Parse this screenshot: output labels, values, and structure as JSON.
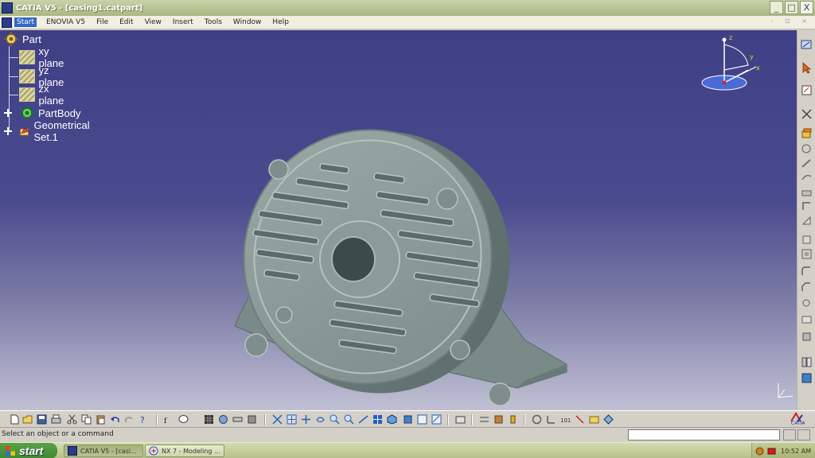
{
  "window": {
    "title": "CATIA V5 - [casing1.catpart]",
    "buttons": [
      "_",
      "□",
      "X"
    ]
  },
  "menu": {
    "items": [
      "Start",
      "ENOVIA V5",
      "File",
      "Edit",
      "View",
      "Insert",
      "Tools",
      "Window",
      "Help"
    ],
    "right": "- ⊡ ×"
  },
  "tree": {
    "root": "Part",
    "planes": [
      "xy plane",
      "yz plane",
      "zx plane"
    ],
    "part_body": "PartBody",
    "geometrical_set": "Geometrical Set.1"
  },
  "compass": {
    "axis_z": "z",
    "axis_y": "y",
    "axis_x": "x"
  },
  "status": {
    "message": "Select an object or a command",
    "input_value": ""
  },
  "branding": {
    "logo_text": "CATIA"
  },
  "taskbar": {
    "start_label": "start",
    "tasks": [
      "CATIA V5 - [casi...",
      "NX 7 - Modeling ..."
    ],
    "clock": "10:52 AM"
  },
  "colors": {
    "viewport_top": "#3f3f86",
    "viewport_bottom": "#c0c0d4",
    "part_fill": "#8b9a98",
    "title_bar": "#a9b882",
    "start_green": "#3c8a2e"
  },
  "icons": {
    "toolbar_bottom": [
      "new-icon",
      "open-icon",
      "save-icon",
      "print-icon",
      "cut-icon",
      "copy-icon",
      "paste-icon",
      "undo-icon",
      "redo-icon",
      "whats-this-icon",
      "formula-icon",
      "comment-icon",
      "catalog-icon",
      "knowledge-icon",
      "measure-icon",
      "fly-icon",
      "fit-all-icon",
      "pan-icon",
      "rotate-icon",
      "zoom-in-icon",
      "zoom-out-icon",
      "normal-view-icon",
      "multi-view-icon",
      "iso-view-icon",
      "shading-icon",
      "hide-show-icon",
      "swap-visible-icon",
      "material-icon",
      "sketch-icon",
      "grid-icon",
      "constraint-icon",
      "analysis-icon",
      "update-icon",
      "axis-icon",
      "publish-icon",
      "catalog2-icon",
      "part-design-icon"
    ],
    "toolbar_right": [
      "sketcher-icon",
      "select-icon",
      "sketch-plane-icon",
      "tools-icon",
      "pad-icon",
      "pocket-icon",
      "shaft-icon",
      "groove-icon",
      "hole-icon",
      "rib-icon",
      "slot-icon",
      "stiffener-icon",
      "loft-icon",
      "fillet-icon",
      "chamfer-icon",
      "draft-icon",
      "shell-icon",
      "thickness-icon",
      "thread-icon",
      "mirror-icon",
      "pattern-icon",
      "scale-icon",
      "boolean-icon",
      "apply-material-icon"
    ]
  }
}
